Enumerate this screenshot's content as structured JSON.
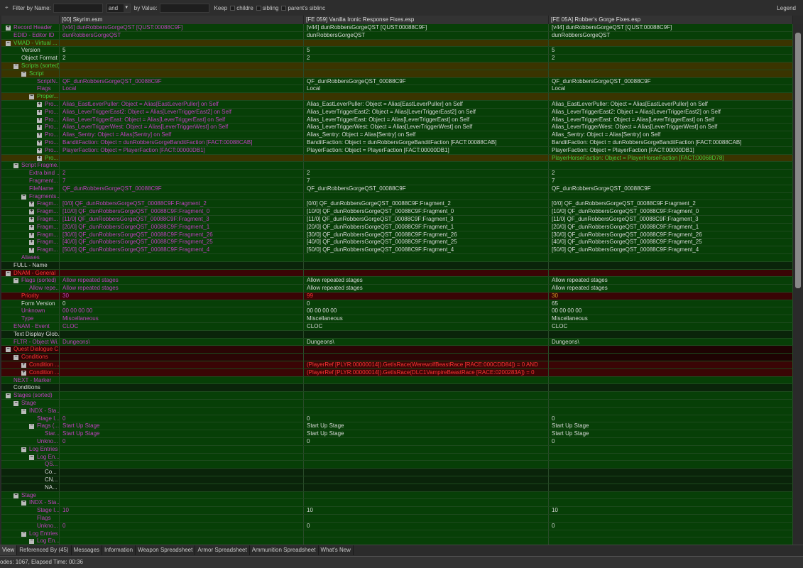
{
  "toolbar": {
    "filter_name_label": "Filter by Name:",
    "filter_name_value": "",
    "op": "and",
    "filter_value_label": "by Value:",
    "filter_value_value": "",
    "keep": "Keep",
    "opt_children": "childre",
    "opt_siblings": "sibling",
    "opt_parents": "parent's siblinc",
    "legend": "Legend"
  },
  "columns": [
    "",
    "[00] Skyrim.esm",
    "[FE 059] Vanilla Ironic Response Fixes.esp",
    "[FE 05A] Robber's Gorge Fixes.esp"
  ],
  "colors": {
    "conflict_loser": "#c040c0",
    "identical": "#d8d8d8",
    "override": "#3fcf3f",
    "critical": "#ff3434",
    "row_green": "#073f07",
    "row_olive": "#3a3400",
    "row_red": "#3a0505"
  },
  "rows": [
    {
      "l": "Record Header",
      "d": 0,
      "e": "+",
      "s": "g",
      "c": "m",
      "v": [
        "[v44] dunRobbersGorgeQST [QUST:00088C9F]",
        "[v44] dunRobbersGorgeQST [QUST:00088C9F]",
        "[v44] dunRobbersGorgeQST [QUST:00088C9F]"
      ],
      "vc": "mww"
    },
    {
      "l": "EDID - Editor ID",
      "d": 0,
      "e": "",
      "s": "g",
      "c": "m",
      "v": [
        "dunRobbersGorgeQST",
        "dunRobbersGorgeQST",
        "dunRobbersGorgeQST"
      ],
      "vc": "mww"
    },
    {
      "l": "VMAD - Virtual ...",
      "d": 0,
      "e": "-",
      "s": "o",
      "c": "g",
      "v": [
        "",
        "",
        ""
      ],
      "vc": "www"
    },
    {
      "l": "Version",
      "d": 1,
      "e": "",
      "s": "g",
      "c": "w",
      "v": [
        "5",
        "5",
        "5"
      ],
      "vc": "www"
    },
    {
      "l": "Object Format",
      "d": 1,
      "e": "",
      "s": "g",
      "c": "w",
      "v": [
        "2",
        "2",
        "2"
      ],
      "vc": "www"
    },
    {
      "l": "Scripts (sorted)",
      "d": 1,
      "e": "-",
      "s": "o",
      "c": "g",
      "v": [
        "",
        "",
        ""
      ],
      "vc": "www"
    },
    {
      "l": "Script",
      "d": 2,
      "e": "-",
      "s": "o",
      "c": "g",
      "v": [
        "",
        "",
        ""
      ],
      "vc": "www"
    },
    {
      "l": "ScriptN...",
      "d": 3,
      "e": "",
      "s": "g",
      "c": "m",
      "v": [
        "QF_dunRobbersGorgeQST_00088C9F",
        "QF_dunRobbersGorgeQST_00088C9F",
        "QF_dunRobbersGorgeQST_00088C9F"
      ],
      "vc": "mww"
    },
    {
      "l": "Flags",
      "d": 3,
      "e": "",
      "s": "g",
      "c": "m",
      "v": [
        "Local",
        "Local",
        "Local"
      ],
      "vc": "mww"
    },
    {
      "l": "Proper...",
      "d": 3,
      "e": "-",
      "s": "o",
      "c": "g",
      "v": [
        "",
        "",
        ""
      ],
      "vc": "www"
    },
    {
      "l": "Pro...",
      "d": 4,
      "e": "+",
      "s": "g",
      "c": "m",
      "v": [
        "Alias_EastLeverPuller: Object = Alias[EastLeverPuller] on Self",
        "Alias_EastLeverPuller: Object = Alias[EastLeverPuller] on Self",
        "Alias_EastLeverPuller: Object = Alias[EastLeverPuller] on Self"
      ],
      "vc": "mww"
    },
    {
      "l": "Pro...",
      "d": 4,
      "e": "+",
      "s": "g",
      "c": "m",
      "v": [
        "Alias_LeverTriggerEast2: Object = Alias[LeverTriggerEast2] on Self",
        "Alias_LeverTriggerEast2: Object = Alias[LeverTriggerEast2] on Self",
        "Alias_LeverTriggerEast2: Object = Alias[LeverTriggerEast2] on Self"
      ],
      "vc": "mww"
    },
    {
      "l": "Pro...",
      "d": 4,
      "e": "+",
      "s": "g",
      "c": "m",
      "v": [
        "Alias_LeverTriggerEast: Object = Alias[LeverTriggerEast] on Self",
        "Alias_LeverTriggerEast: Object = Alias[LeverTriggerEast] on Self",
        "Alias_LeverTriggerEast: Object = Alias[LeverTriggerEast] on Self"
      ],
      "vc": "mww"
    },
    {
      "l": "Pro...",
      "d": 4,
      "e": "+",
      "s": "g",
      "c": "m",
      "v": [
        "Alias_LeverTriggerWest: Object = Alias[LeverTriggerWest] on Self",
        "Alias_LeverTriggerWest: Object = Alias[LeverTriggerWest] on Self",
        "Alias_LeverTriggerWest: Object = Alias[LeverTriggerWest] on Self"
      ],
      "vc": "mww"
    },
    {
      "l": "Pro...",
      "d": 4,
      "e": "+",
      "s": "g",
      "c": "m",
      "v": [
        "Alias_Sentry: Object = Alias[Sentry] on Self",
        "Alias_Sentry: Object = Alias[Sentry] on Self",
        "Alias_Sentry: Object = Alias[Sentry] on Self"
      ],
      "vc": "mww"
    },
    {
      "l": "Pro...",
      "d": 4,
      "e": "+",
      "s": "g",
      "c": "m",
      "v": [
        "BanditFaction: Object = dunRobbersGorgeBanditFaction [FACT:00088CAB]",
        "BanditFaction: Object = dunRobbersGorgeBanditFaction [FACT:00088CAB]",
        "BanditFaction: Object = dunRobbersGorgeBanditFaction [FACT:00088CAB]"
      ],
      "vc": "mww"
    },
    {
      "l": "Pro...",
      "d": 4,
      "e": "+",
      "s": "g",
      "c": "m",
      "v": [
        "PlayerFaction: Object = PlayerFaction [FACT:00000DB1]",
        "PlayerFaction: Object = PlayerFaction [FACT:00000DB1]",
        "PlayerFaction: Object = PlayerFaction [FACT:00000DB1]"
      ],
      "vc": "mww"
    },
    {
      "l": "Pro...",
      "d": 4,
      "e": "+",
      "s": "o",
      "c": "g",
      "v": [
        "",
        "",
        "PlayerHorseFaction: Object = PlayerHorseFaction [FACT:00068D78]"
      ],
      "vc": "wwg"
    },
    {
      "l": "Script Fragme...",
      "d": 1,
      "e": "-",
      "s": "g",
      "c": "m",
      "v": [
        "",
        "",
        ""
      ],
      "vc": "www"
    },
    {
      "l": "Extra bind ...",
      "d": 2,
      "e": "",
      "s": "g",
      "c": "m",
      "v": [
        "2",
        "2",
        "2"
      ],
      "vc": "mww"
    },
    {
      "l": "Fragment...",
      "d": 2,
      "e": "",
      "s": "g",
      "c": "m",
      "v": [
        "7",
        "7",
        "7"
      ],
      "vc": "mww"
    },
    {
      "l": "FileName",
      "d": 2,
      "e": "",
      "s": "g",
      "c": "m",
      "v": [
        "QF_dunRobbersGorgeQST_00088C9F",
        "QF_dunRobbersGorgeQST_00088C9F",
        "QF_dunRobbersGorgeQST_00088C9F"
      ],
      "vc": "mww"
    },
    {
      "l": "Fragments...",
      "d": 2,
      "e": "-",
      "s": "g",
      "c": "m",
      "v": [
        "",
        "",
        ""
      ],
      "vc": "www"
    },
    {
      "l": "Fragm...",
      "d": 3,
      "e": "+",
      "s": "g",
      "c": "m",
      "v": [
        "[0/0] QF_dunRobbersGorgeQST_00088C9F:Fragment_2",
        "[0/0] QF_dunRobbersGorgeQST_00088C9F:Fragment_2",
        "[0/0] QF_dunRobbersGorgeQST_00088C9F:Fragment_2"
      ],
      "vc": "mww"
    },
    {
      "l": "Fragm...",
      "d": 3,
      "e": "+",
      "s": "g",
      "c": "m",
      "v": [
        "[10/0] QF_dunRobbersGorgeQST_00088C9F:Fragment_0",
        "[10/0] QF_dunRobbersGorgeQST_00088C9F:Fragment_0",
        "[10/0] QF_dunRobbersGorgeQST_00088C9F:Fragment_0"
      ],
      "vc": "mww"
    },
    {
      "l": "Fragm...",
      "d": 3,
      "e": "+",
      "s": "g",
      "c": "m",
      "v": [
        "[11/0] QF_dunRobbersGorgeQST_00088C9F:Fragment_3",
        "[11/0] QF_dunRobbersGorgeQST_00088C9F:Fragment_3",
        "[11/0] QF_dunRobbersGorgeQST_00088C9F:Fragment_3"
      ],
      "vc": "mww"
    },
    {
      "l": "Fragm...",
      "d": 3,
      "e": "+",
      "s": "g",
      "c": "m",
      "v": [
        "[20/0] QF_dunRobbersGorgeQST_00088C9F:Fragment_1",
        "[20/0] QF_dunRobbersGorgeQST_00088C9F:Fragment_1",
        "[20/0] QF_dunRobbersGorgeQST_00088C9F:Fragment_1"
      ],
      "vc": "mww"
    },
    {
      "l": "Fragm...",
      "d": 3,
      "e": "+",
      "s": "g",
      "c": "m",
      "v": [
        "[30/0] QF_dunRobbersGorgeQST_00088C9F:Fragment_26",
        "[30/0] QF_dunRobbersGorgeQST_00088C9F:Fragment_26",
        "[30/0] QF_dunRobbersGorgeQST_00088C9F:Fragment_26"
      ],
      "vc": "mww"
    },
    {
      "l": "Fragm...",
      "d": 3,
      "e": "+",
      "s": "g",
      "c": "m",
      "v": [
        "[40/0] QF_dunRobbersGorgeQST_00088C9F:Fragment_25",
        "[40/0] QF_dunRobbersGorgeQST_00088C9F:Fragment_25",
        "[40/0] QF_dunRobbersGorgeQST_00088C9F:Fragment_25"
      ],
      "vc": "mww"
    },
    {
      "l": "Fragm...",
      "d": 3,
      "e": "+",
      "s": "g",
      "c": "m",
      "v": [
        "[50/0] QF_dunRobbersGorgeQST_00088C9F:Fragment_4",
        "[50/0] QF_dunRobbersGorgeQST_00088C9F:Fragment_4",
        "[50/0] QF_dunRobbersGorgeQST_00088C9F:Fragment_4"
      ],
      "vc": "mww"
    },
    {
      "l": "Aliases",
      "d": 1,
      "e": "",
      "s": "g",
      "c": "m",
      "v": [
        "",
        "",
        ""
      ],
      "vc": "www"
    },
    {
      "l": "FULL - Name",
      "d": 0,
      "e": "",
      "s": "d",
      "c": "w",
      "v": [
        "",
        "",
        ""
      ],
      "vc": "www"
    },
    {
      "l": "DNAM - General",
      "d": 0,
      "e": "-",
      "s": "r",
      "c": "r",
      "v": [
        "",
        "",
        ""
      ],
      "vc": "www"
    },
    {
      "l": "Flags (sorted)",
      "d": 1,
      "e": "-",
      "s": "g",
      "c": "m",
      "v": [
        "Allow repeated stages",
        "Allow repeated stages",
        "Allow repeated stages"
      ],
      "vc": "mww"
    },
    {
      "l": "Allow repe...",
      "d": 2,
      "e": "",
      "s": "g",
      "c": "m",
      "v": [
        "Allow repeated stages",
        "Allow repeated stages",
        "Allow repeated stages"
      ],
      "vc": "mww"
    },
    {
      "l": "Priority",
      "d": 1,
      "e": "",
      "s": "r",
      "c": "r",
      "v": [
        "30",
        "99",
        "30"
      ],
      "vc": "mro"
    },
    {
      "l": "Form Version",
      "d": 1,
      "e": "",
      "s": "g",
      "c": "w",
      "v": [
        "0",
        "0",
        "65"
      ],
      "vc": "www"
    },
    {
      "l": "Unknown",
      "d": 1,
      "e": "",
      "s": "g",
      "c": "m",
      "v": [
        "00 00 00 00",
        "00 00 00 00",
        "00 00 00 00"
      ],
      "vc": "mww"
    },
    {
      "l": "Type",
      "d": 1,
      "e": "",
      "s": "g",
      "c": "m",
      "v": [
        "Miscellaneous",
        "Miscellaneous",
        "Miscellaneous"
      ],
      "vc": "mww"
    },
    {
      "l": "ENAM - Event",
      "d": 0,
      "e": "",
      "s": "g",
      "c": "m",
      "v": [
        "CLOC",
        "CLOC",
        "CLOC"
      ],
      "vc": "mww"
    },
    {
      "l": "Text Display Glob...",
      "d": 0,
      "e": "",
      "s": "d",
      "c": "w",
      "v": [
        "",
        "",
        ""
      ],
      "vc": "www"
    },
    {
      "l": "FLTR - Object Wi...",
      "d": 0,
      "e": "",
      "s": "g",
      "c": "m",
      "v": [
        "Dungeons\\",
        "Dungeons\\",
        "Dungeons\\"
      ],
      "vc": "mww"
    },
    {
      "l": "Quest Dialogue C...",
      "d": 0,
      "e": "-",
      "s": "dr",
      "c": "r",
      "v": [
        "",
        "",
        ""
      ],
      "vc": "www"
    },
    {
      "l": "Conditions",
      "d": 1,
      "e": "-",
      "s": "dr",
      "c": "r",
      "v": [
        "",
        "",
        ""
      ],
      "vc": "www"
    },
    {
      "l": "Condition ...",
      "d": 2,
      "e": "+",
      "s": "r",
      "c": "r",
      "v": [
        "",
        "(PlayerRef [PLYR:00000014]).GetIsRace(WerewolfBeastRace [RACE:000CDD84]) = 0 AND",
        ""
      ],
      "vc": "wrw"
    },
    {
      "l": "Condition ...",
      "d": 2,
      "e": "+",
      "s": "r",
      "c": "r",
      "v": [
        "",
        "(PlayerRef [PLYR:00000014]).GetIsRace(DLC1VampireBeastRace [RACE:0200283A]) = 0",
        ""
      ],
      "vc": "wrw"
    },
    {
      "l": "NEXT - Marker",
      "d": 0,
      "e": "",
      "s": "g",
      "c": "m",
      "v": [
        "",
        "",
        ""
      ],
      "vc": "www"
    },
    {
      "l": "Conditions",
      "d": 0,
      "e": "",
      "s": "d",
      "c": "w",
      "v": [
        "",
        "",
        ""
      ],
      "vc": "www"
    },
    {
      "l": "Stages (sorted)",
      "d": 0,
      "e": "-",
      "s": "g",
      "c": "m",
      "v": [
        "",
        "",
        ""
      ],
      "vc": "www"
    },
    {
      "l": "Stage",
      "d": 1,
      "e": "-",
      "s": "g",
      "c": "m",
      "v": [
        "",
        "",
        ""
      ],
      "vc": "www"
    },
    {
      "l": "INDX - Sta...",
      "d": 2,
      "e": "-",
      "s": "g",
      "c": "m",
      "v": [
        "",
        "",
        ""
      ],
      "vc": "www"
    },
    {
      "l": "Stage I...",
      "d": 3,
      "e": "",
      "s": "g",
      "c": "m",
      "v": [
        "0",
        "0",
        "0"
      ],
      "vc": "mww"
    },
    {
      "l": "Flags (...",
      "d": 3,
      "e": "-",
      "s": "g",
      "c": "m",
      "v": [
        "Start Up Stage",
        "Start Up Stage",
        "Start Up Stage"
      ],
      "vc": "mww"
    },
    {
      "l": "Star...",
      "d": 4,
      "e": "",
      "s": "g",
      "c": "m",
      "v": [
        "Start Up Stage",
        "Start Up Stage",
        "Start Up Stage"
      ],
      "vc": "mww"
    },
    {
      "l": "Unkno...",
      "d": 3,
      "e": "",
      "s": "g",
      "c": "m",
      "v": [
        "0",
        "0",
        "0"
      ],
      "vc": "mww"
    },
    {
      "l": "Log Entries",
      "d": 2,
      "e": "-",
      "s": "g",
      "c": "m",
      "v": [
        "",
        "",
        ""
      ],
      "vc": "www"
    },
    {
      "l": "Log En...",
      "d": 3,
      "e": "-",
      "s": "g",
      "c": "m",
      "v": [
        "",
        "",
        ""
      ],
      "vc": "www"
    },
    {
      "l": "QS...",
      "d": 4,
      "e": "",
      "s": "g",
      "c": "m",
      "v": [
        "",
        "",
        ""
      ],
      "vc": "www"
    },
    {
      "l": "Co...",
      "d": 4,
      "e": "",
      "s": "d",
      "c": "w",
      "v": [
        "",
        "",
        ""
      ],
      "vc": "www"
    },
    {
      "l": "CN...",
      "d": 4,
      "e": "",
      "s": "d",
      "c": "w",
      "v": [
        "",
        "",
        ""
      ],
      "vc": "www"
    },
    {
      "l": "NA...",
      "d": 4,
      "e": "",
      "s": "d",
      "c": "w",
      "v": [
        "",
        "",
        ""
      ],
      "vc": "www"
    },
    {
      "l": "Stage",
      "d": 1,
      "e": "-",
      "s": "g",
      "c": "m",
      "v": [
        "",
        "",
        ""
      ],
      "vc": "www"
    },
    {
      "l": "INDX - Sta...",
      "d": 2,
      "e": "-",
      "s": "g",
      "c": "m",
      "v": [
        "",
        "",
        ""
      ],
      "vc": "www"
    },
    {
      "l": "Stage I...",
      "d": 3,
      "e": "",
      "s": "g",
      "c": "m",
      "v": [
        "10",
        "10",
        "10"
      ],
      "vc": "mww"
    },
    {
      "l": "Flags",
      "d": 3,
      "e": "",
      "s": "g",
      "c": "m",
      "v": [
        "",
        "",
        ""
      ],
      "vc": "www"
    },
    {
      "l": "Unkno...",
      "d": 3,
      "e": "",
      "s": "g",
      "c": "m",
      "v": [
        "0",
        "0",
        "0"
      ],
      "vc": "mww"
    },
    {
      "l": "Log Entries",
      "d": 2,
      "e": "-",
      "s": "g",
      "c": "m",
      "v": [
        "",
        "",
        ""
      ],
      "vc": "www"
    },
    {
      "l": "Log En...",
      "d": 3,
      "e": "-",
      "s": "g",
      "c": "m",
      "v": [
        "",
        "",
        ""
      ],
      "vc": "www"
    }
  ],
  "tabs": [
    "View",
    "Referenced By (45)",
    "Messages",
    "Information",
    "Weapon Spreadsheet",
    "Armor Spreadsheet",
    "Ammunition Spreadsheet",
    "What's New"
  ],
  "active_tab": "View",
  "status": "odes: 1067, Elapsed Time: 00:36"
}
